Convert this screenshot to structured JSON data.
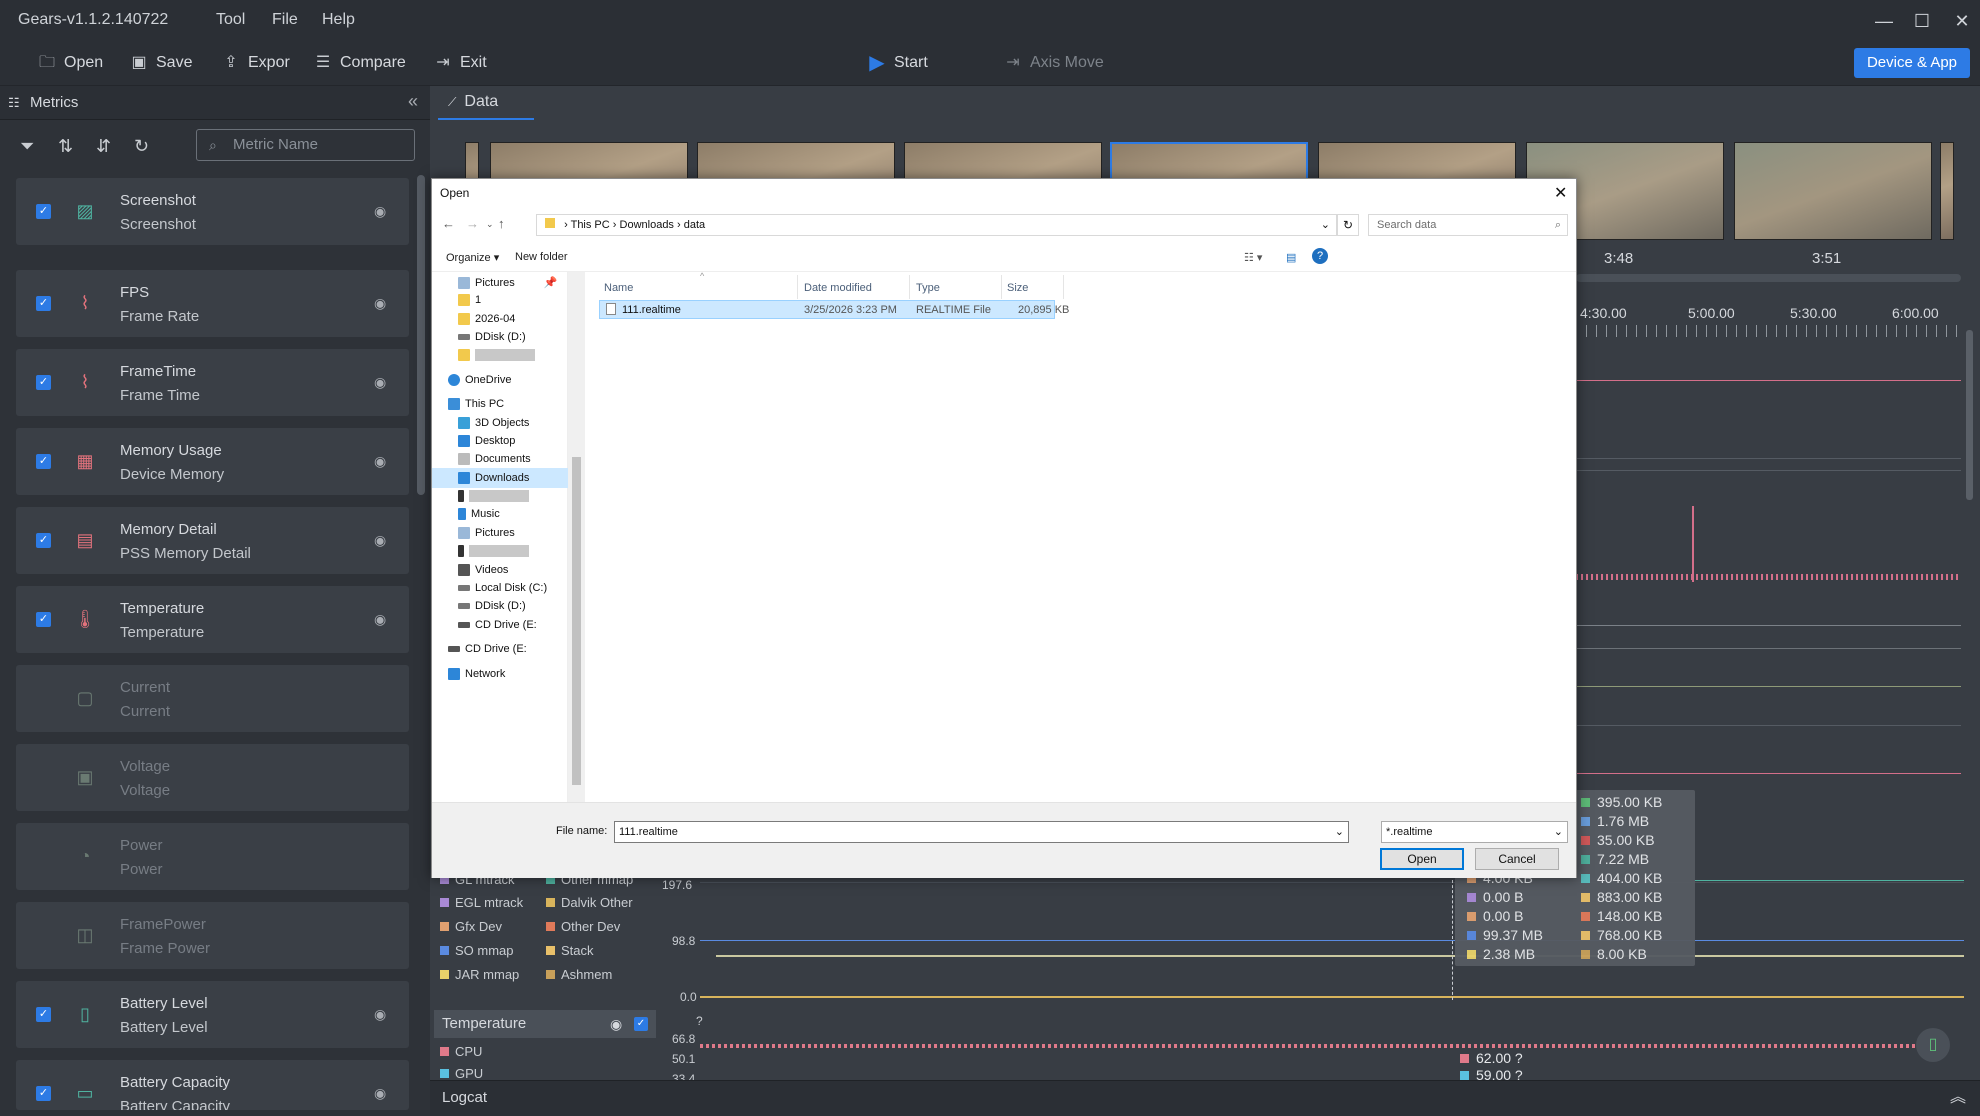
{
  "app": {
    "title": "Gears-v1.1.2.140722"
  },
  "menu": [
    "Tool",
    "File",
    "Help"
  ],
  "toolbar": {
    "open": "Open",
    "save": "Save",
    "export": "Expor",
    "compare": "Compare",
    "exit": "Exit",
    "start": "Start",
    "axis_move": "Axis Move",
    "device_app": "Device & App"
  },
  "sidebar": {
    "title": "Metrics",
    "search_placeholder": "Metric Name",
    "metrics": [
      {
        "name": "Screenshot",
        "sub": "Screenshot",
        "checked": true
      },
      {
        "name": "FPS",
        "sub": "Frame Rate",
        "checked": true
      },
      {
        "name": "FrameTime",
        "sub": "Frame Time",
        "checked": true
      },
      {
        "name": "Memory Usage",
        "sub": "Device Memory",
        "checked": true
      },
      {
        "name": "Memory Detail",
        "sub": "PSS Memory Detail",
        "checked": true
      },
      {
        "name": "Temperature",
        "sub": "Temperature",
        "checked": true
      },
      {
        "name": "Current",
        "sub": "Current",
        "checked": false
      },
      {
        "name": "Voltage",
        "sub": "Voltage",
        "checked": false
      },
      {
        "name": "Power",
        "sub": "Power",
        "checked": false
      },
      {
        "name": "FramePower",
        "sub": "Frame Power",
        "checked": false
      },
      {
        "name": "Battery Level",
        "sub": "Battery Level",
        "checked": true
      },
      {
        "name": "Battery Capacity",
        "sub": "Battery Capacity",
        "checked": true
      }
    ]
  },
  "data_tab": "Data",
  "timeline": {
    "thumb_labels": [
      "3:48",
      "3:51"
    ],
    "axis_labels": [
      "4:30.00",
      "5:00.00",
      "5:30.00",
      "6:00.00"
    ]
  },
  "memory_legend": {
    "left_items": [
      "GL mtrack",
      "Other mmap",
      "EGL mtrack",
      "Dalvik Other",
      "Gfx Dev",
      "Other Dev",
      "SO mmap",
      "Stack",
      "JAR mmap",
      "Ashmem"
    ],
    "tooltip_left": [
      "395.00  KB",
      "1.76  MB",
      "35.00  KB",
      "7.22  MB",
      "404.00  KB",
      "0.00  B",
      "0.00  B",
      "99.37  MB",
      "2.38  MB"
    ],
    "tooltip_right": [
      "4.00  KB",
      "883.00  KB",
      "148.00  KB",
      "768.00  KB",
      "8.00  KB"
    ],
    "y_ticks": [
      "197.6",
      "98.8",
      "0.0"
    ]
  },
  "temperature": {
    "title": "Temperature",
    "items": [
      "CPU",
      "GPU"
    ],
    "y_ticks": [
      "?",
      "66.8",
      "50.1",
      "33.4"
    ],
    "tooltip": [
      "62.00  ?",
      "59.00  ?"
    ]
  },
  "logcat": "Logcat",
  "dialog": {
    "title": "Open",
    "path": [
      "This PC",
      "Downloads",
      "data"
    ],
    "search_placeholder": "Search data",
    "organize": "Organize",
    "new_folder": "New folder",
    "tree": [
      "Pictures",
      "1",
      "2026-04",
      "DDisk (D:)",
      "OneDrive",
      "This PC",
      "3D Objects",
      "Desktop",
      "Documents",
      "Downloads",
      "Music",
      "Pictures",
      "Videos",
      "Local Disk (C:)",
      "DDisk (D:)",
      "CD Drive (E:",
      "CD Drive (E:",
      "Network"
    ],
    "columns": [
      "Name",
      "Date modified",
      "Type",
      "Size"
    ],
    "files": [
      {
        "name": "111.realtime",
        "date": "3/25/2026 3:23 PM",
        "type": "REALTIME File",
        "size": "20,895 KB"
      }
    ],
    "file_name_label": "File name:",
    "file_name": "111.realtime",
    "file_type": "*.realtime",
    "open": "Open",
    "cancel": "Cancel"
  }
}
